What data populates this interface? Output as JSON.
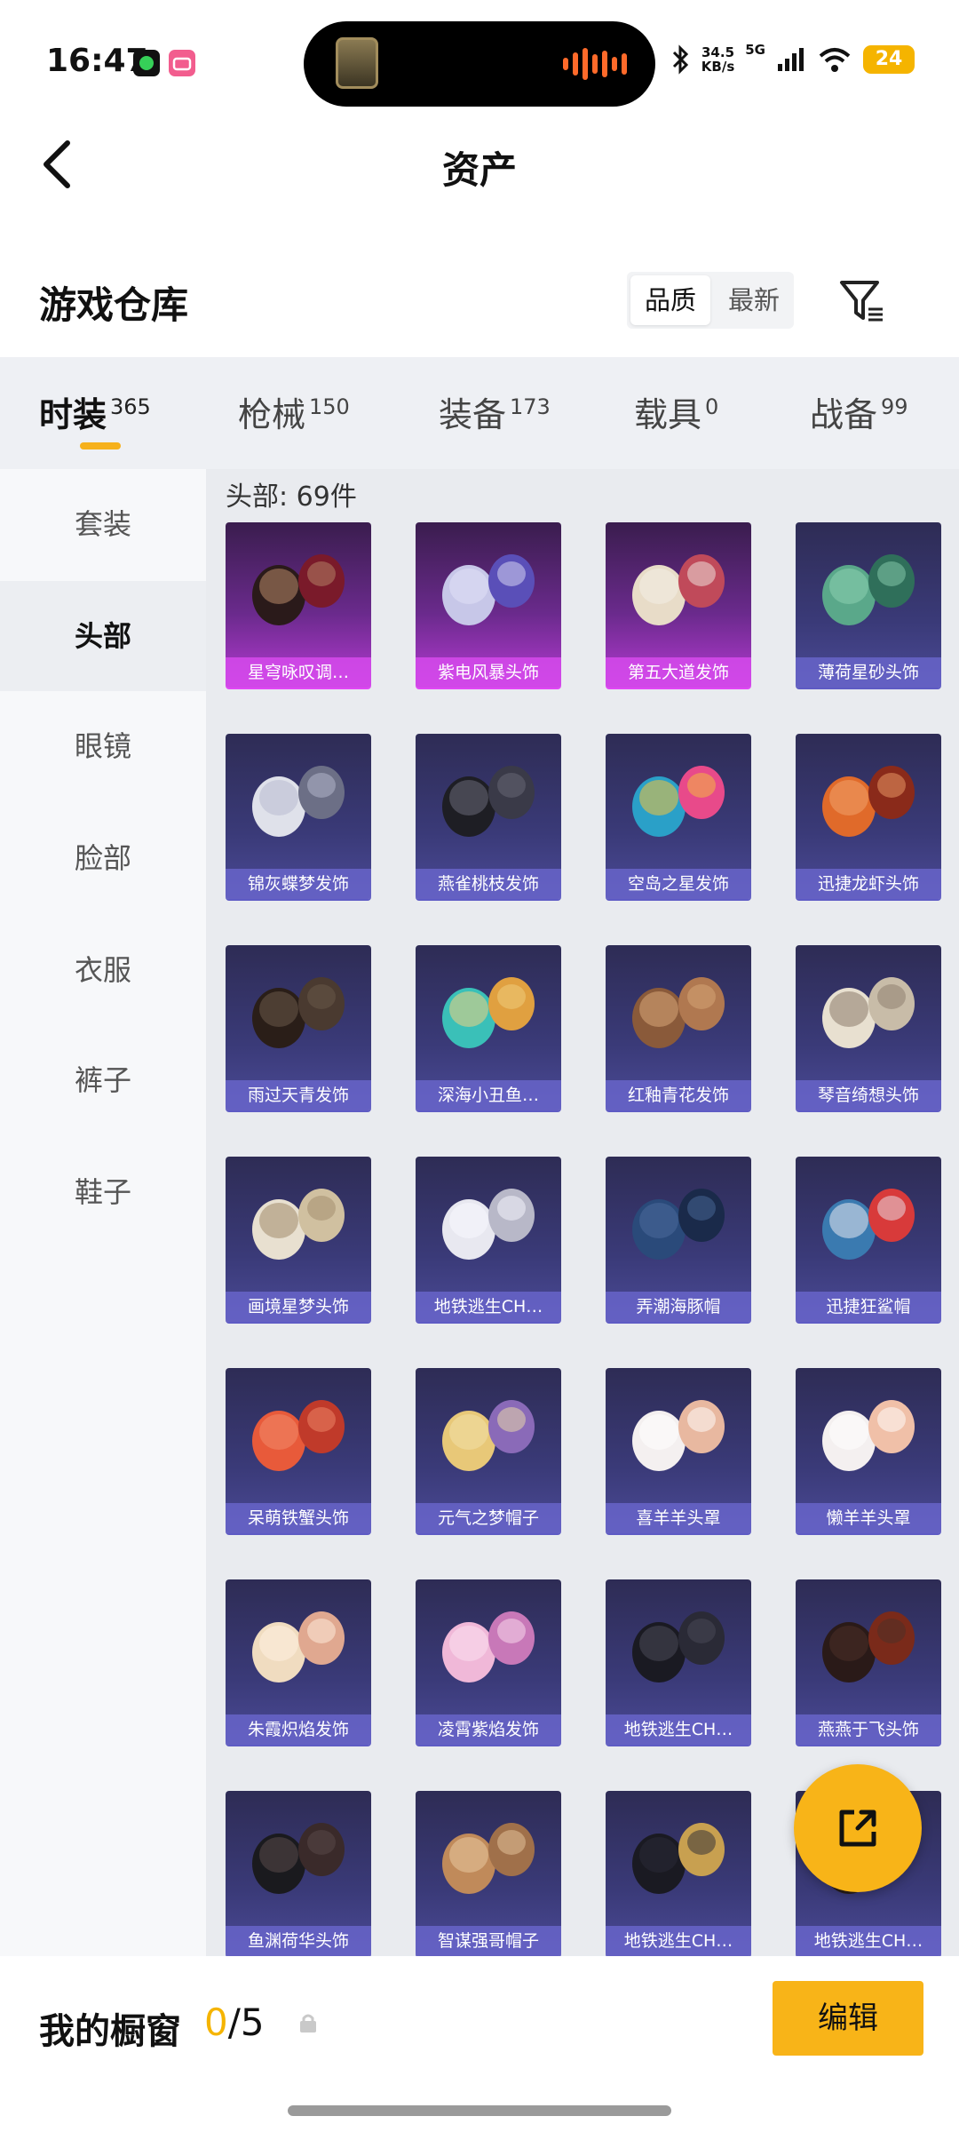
{
  "status_bar": {
    "time": "16:47",
    "net_speed_value": "34.5",
    "net_speed_unit": "KB/s",
    "network": "5G",
    "battery": "24"
  },
  "header": {
    "title": "资产",
    "back_icon": "chevron-left-icon"
  },
  "warehouse": {
    "title": "游戏仓库",
    "sort_quality": "品质",
    "sort_latest": "最新",
    "filter_icon": "filter-icon"
  },
  "categories": [
    {
      "label": "时装",
      "count": "365"
    },
    {
      "label": "枪械",
      "count": "150"
    },
    {
      "label": "装备",
      "count": "173"
    },
    {
      "label": "载具",
      "count": "0"
    },
    {
      "label": "战备",
      "count": "99"
    }
  ],
  "sidebar": {
    "items": [
      "套装",
      "头部",
      "眼镜",
      "脸部",
      "衣服",
      "裤子",
      "鞋子"
    ]
  },
  "grid": {
    "count_label": "头部: 69件",
    "items": [
      {
        "name": "星穹咏叹调…",
        "rarity": "legendary"
      },
      {
        "name": "紫电风暴头饰",
        "rarity": "legendary"
      },
      {
        "name": "第五大道发饰",
        "rarity": "legendary"
      },
      {
        "name": "薄荷星砂头饰",
        "rarity": "epic"
      },
      {
        "name": "锦灰蝶梦发饰",
        "rarity": "epic"
      },
      {
        "name": "燕雀桃枝发饰",
        "rarity": "epic"
      },
      {
        "name": "空岛之星发饰",
        "rarity": "epic"
      },
      {
        "name": "迅捷龙虾头饰",
        "rarity": "epic"
      },
      {
        "name": "雨过天青发饰",
        "rarity": "epic"
      },
      {
        "name": "深海小丑鱼…",
        "rarity": "epic"
      },
      {
        "name": "红釉青花发饰",
        "rarity": "epic"
      },
      {
        "name": "琴音绮想头饰",
        "rarity": "epic"
      },
      {
        "name": "画境星梦头饰",
        "rarity": "epic"
      },
      {
        "name": "地铁逃生CH…",
        "rarity": "epic"
      },
      {
        "name": "弄潮海豚帽",
        "rarity": "epic"
      },
      {
        "name": "迅捷狂鲨帽",
        "rarity": "epic"
      },
      {
        "name": "呆萌铁蟹头饰",
        "rarity": "epic"
      },
      {
        "name": "元气之梦帽子",
        "rarity": "epic"
      },
      {
        "name": "喜羊羊头罩",
        "rarity": "epic"
      },
      {
        "name": "懒羊羊头罩",
        "rarity": "epic"
      },
      {
        "name": "朱霞炽焰发饰",
        "rarity": "epic"
      },
      {
        "name": "凌霄紫焰发饰",
        "rarity": "epic"
      },
      {
        "name": "地铁逃生CH…",
        "rarity": "epic"
      },
      {
        "name": "燕燕于飞头饰",
        "rarity": "epic"
      },
      {
        "name": "鱼渊荷华头饰",
        "rarity": "epic"
      },
      {
        "name": "智谋强哥帽子",
        "rarity": "epic"
      },
      {
        "name": "地铁逃生CH…",
        "rarity": "epic"
      },
      {
        "name": "地铁逃生CH…",
        "rarity": "epic"
      }
    ]
  },
  "showcase": {
    "label": "我的橱窗",
    "current": "0",
    "total": "/5",
    "edit_label": "编辑"
  },
  "colors": {
    "accent": "#f8b418",
    "legendary": "#d64aec",
    "epic": "#6c68d2"
  }
}
